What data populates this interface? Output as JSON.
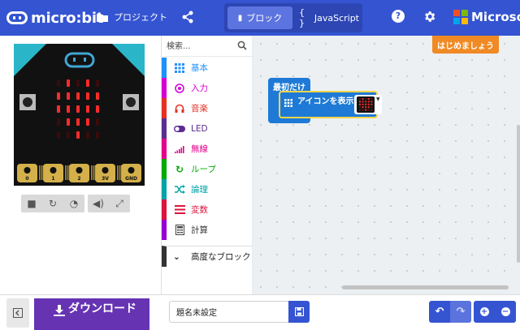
{
  "header": {
    "brand": "micro:bit",
    "projects_label": "プロジェクト",
    "blocks_label": "ブロック",
    "javascript_label": "JavaScript",
    "help_glyph": "?",
    "microsoft_label": "Microsoft",
    "brand_color": "#3454d1"
  },
  "simulator": {
    "board_color": "#111111",
    "led_on_color": "#ff2b2b",
    "led_off_color": "#3a0b0b",
    "pin_labels": [
      "0",
      "1",
      "2",
      "3V",
      "GND"
    ],
    "controls": [
      "stop-icon",
      "restart-icon",
      "slow-mo-icon",
      "mute-icon",
      "fullscreen-icon"
    ]
  },
  "toolbox": {
    "search_placeholder": "検索...",
    "categories": [
      {
        "label": "基本",
        "color": "#1e90ff",
        "icon": "grid-icon"
      },
      {
        "label": "入力",
        "color": "#d400d4",
        "icon": "input-icon"
      },
      {
        "label": "音楽",
        "color": "#e63022",
        "icon": "headphones-icon"
      },
      {
        "label": "LED",
        "color": "#5c2d91",
        "icon": "toggle-icon"
      },
      {
        "label": "無線",
        "color": "#e3008c",
        "icon": "signal-bars-icon"
      },
      {
        "label": "ループ",
        "color": "#00aa00",
        "icon": "loop-icon"
      },
      {
        "label": "論理",
        "color": "#00a4a6",
        "icon": "shuffle-icon"
      },
      {
        "label": "変数",
        "color": "#dc143c",
        "icon": "variables-icon"
      },
      {
        "label": "計算",
        "color": "#9400d3",
        "icon": "calculator-icon"
      }
    ],
    "advanced_label": "高度なブロック"
  },
  "workspace": {
    "tutorial_label": "はじめましょう",
    "on_start_label": "最初だけ",
    "show_icon_label": "アイコンを表示"
  },
  "bottom": {
    "download_label": "ダウンロード",
    "project_name": "題名未設定",
    "undo_glyph": "↶",
    "redo_glyph": "↷"
  }
}
